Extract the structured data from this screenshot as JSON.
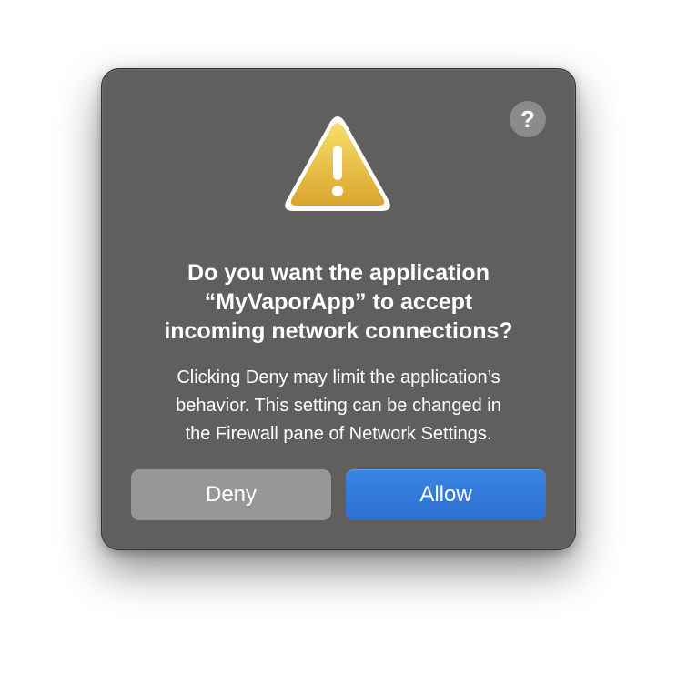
{
  "dialog": {
    "help_label": "?",
    "icon": "warning-triangle-icon",
    "title_lines": [
      "Do you want the application",
      "“MyVaporApp” to accept",
      "incoming network connections?"
    ],
    "message_lines": [
      "Clicking Deny may limit the application’s",
      "behavior. This setting can be changed in",
      "the Firewall pane of Network Settings."
    ],
    "deny_label": "Deny",
    "allow_label": "Allow"
  },
  "colors": {
    "dialog_background": "#615f5d",
    "allow_button": "#2f74d8",
    "deny_button": "#999795",
    "warning_yellow": "#e7b93a"
  }
}
